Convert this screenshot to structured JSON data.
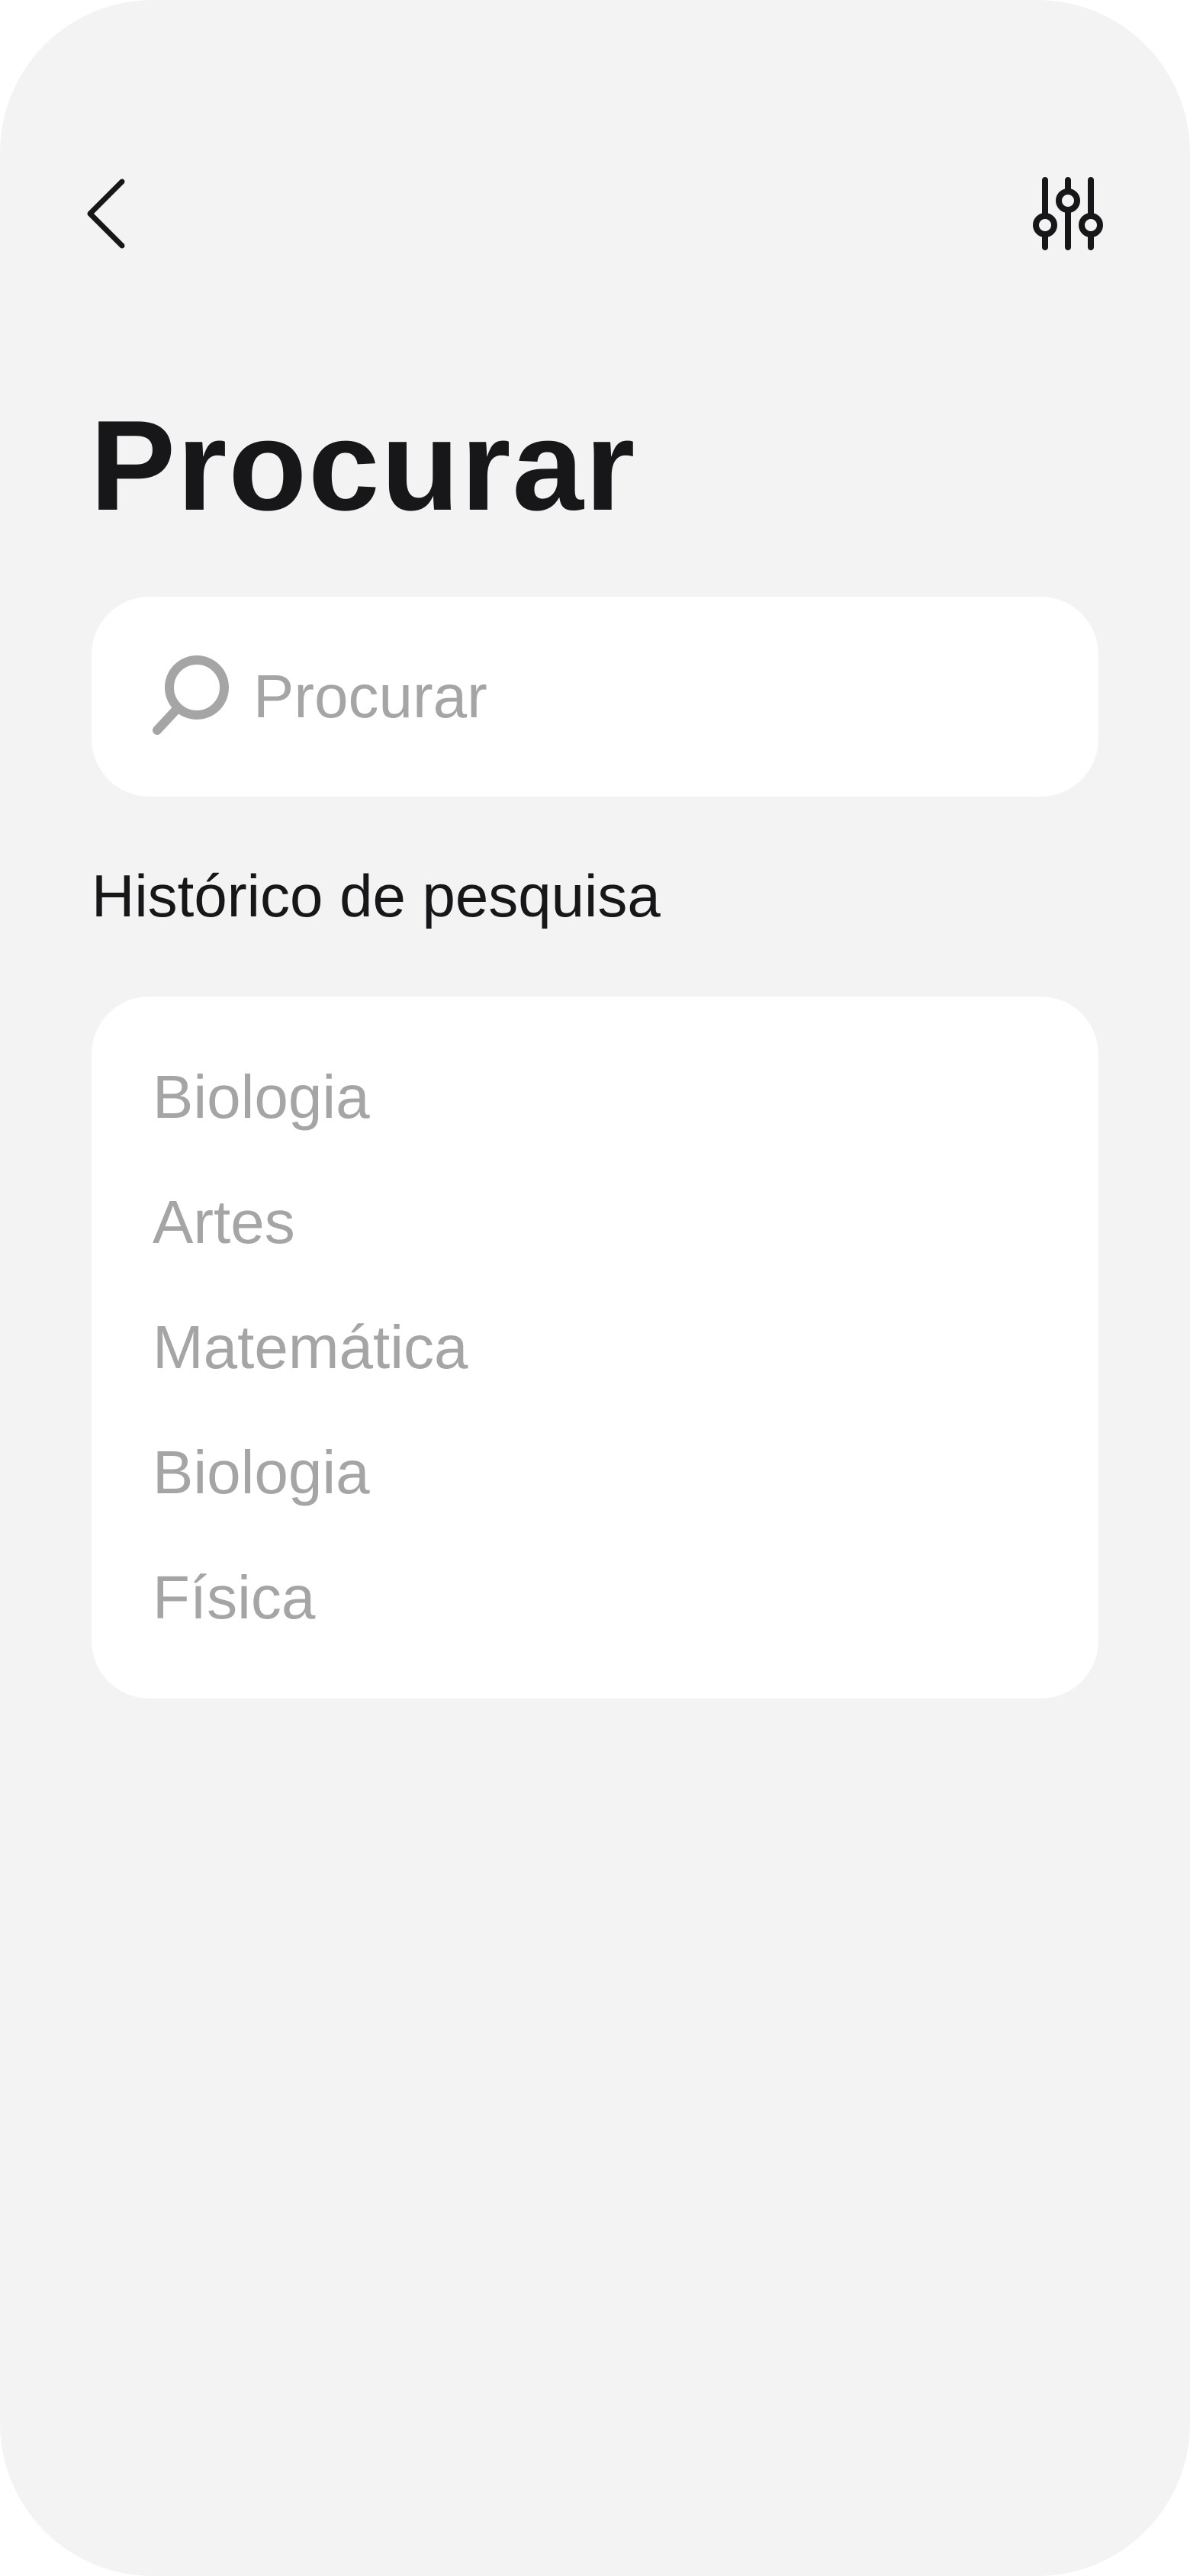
{
  "header": {
    "back_icon": "chevron-left-icon",
    "filter_icon": "sliders-icon",
    "title": "Procurar"
  },
  "search": {
    "placeholder": "Procurar",
    "value": "",
    "icon": "search-icon"
  },
  "history": {
    "heading": "Histórico de pesquisa",
    "items": [
      {
        "label": "Biologia"
      },
      {
        "label": "Artes"
      },
      {
        "label": "Matemática"
      },
      {
        "label": "Biologia"
      },
      {
        "label": "Física"
      }
    ]
  },
  "colors": {
    "background": "#f3f3f3",
    "card": "#ffffff",
    "text_primary": "#17171a",
    "text_muted": "#a5a5a5"
  }
}
